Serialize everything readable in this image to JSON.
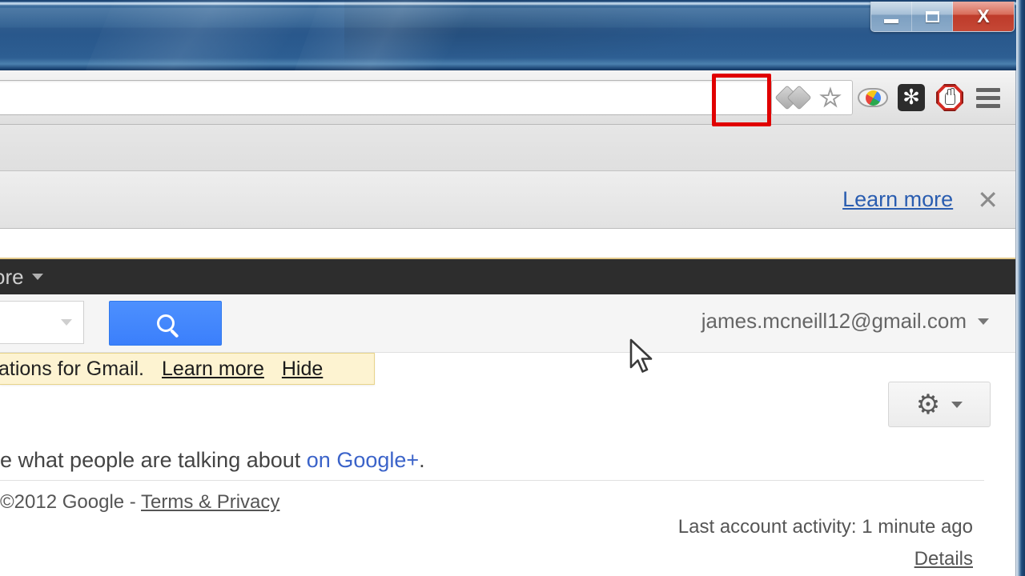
{
  "window": {
    "controls": {
      "minimize_label": "—",
      "maximize_label": "",
      "close_label": "X"
    }
  },
  "browser": {
    "toolbar": {
      "omnibox_value": "",
      "omnibox_placeholder": "",
      "icons": [
        {
          "name": "extension-gem-icon",
          "label": ""
        },
        {
          "name": "bookmark-star-icon",
          "label": ""
        },
        {
          "name": "eye-extension-icon",
          "label": ""
        },
        {
          "name": "asterisk-extension-icon",
          "glyph": "✻"
        },
        {
          "name": "adblock-extension-icon",
          "label": ""
        },
        {
          "name": "chrome-menu-icon",
          "label": ""
        }
      ]
    },
    "infobar": {
      "learn_more_label": "Learn more",
      "close_label": "✕"
    }
  },
  "gmail": {
    "gbar": {
      "more_label": "ore"
    },
    "search": {
      "input_value": "",
      "search_button_label": ""
    },
    "account": {
      "email": "james.mcneill12@gmail.com"
    },
    "notice": {
      "text": "ations for Gmail.",
      "learn_more_label": "Learn more",
      "hide_label": "Hide"
    },
    "settings": {
      "gear_label": "⚙"
    },
    "promo": {
      "text_before": "e what people are talking about ",
      "link_label": "on Google+",
      "text_after": "."
    },
    "footer": {
      "copyright": "©2012 Google - ",
      "terms_label": "Terms & Privacy",
      "last_activity": "Last account activity: 1 minute ago",
      "details_label": "Details"
    }
  },
  "colors": {
    "titlebar_blue": "#2d5e92",
    "close_red": "#c0392b",
    "highlight_red": "#e00000",
    "google_blue": "#4d90fe",
    "link_blue": "#2a5db0",
    "notice_yellow": "#fdf3d1",
    "gbar_black": "#2d2d2d"
  }
}
